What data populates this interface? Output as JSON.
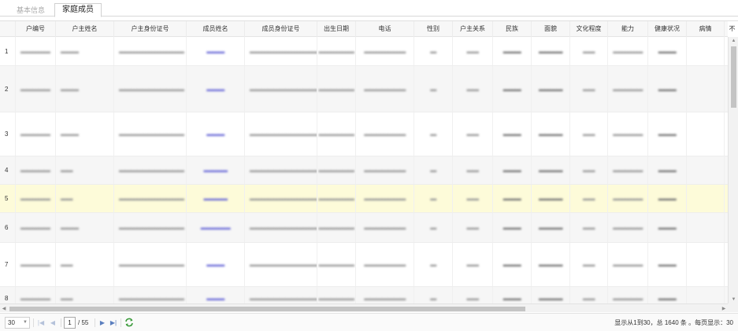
{
  "tabs": [
    {
      "label": "基本信息",
      "active": false
    },
    {
      "label": "家庭成员",
      "active": true
    }
  ],
  "columns": [
    "",
    "户编号",
    "户主姓名",
    "户主身份证号",
    "成员姓名",
    "成员身份证号",
    "出生日期",
    "电话",
    "性别",
    "户主关系",
    "民族",
    "面貌",
    "文化程度",
    "能力",
    "健康状况",
    "病情",
    "不"
  ],
  "rows": [
    {
      "num": "1",
      "cells": [
        "▬▬▬▬▬",
        "▬▬▬",
        "▬▬▬▬▬▬▬▬▬▬▬",
        "▬▬▬",
        "▬▬▬▬▬▬▬▬▬▬▬▬",
        "▬▬▬▬▬▬",
        "▬▬▬▬▬▬▬",
        "▬",
        "▬▬",
        "▬▬▬",
        "▬▬▬▬",
        "▬▬",
        "▬▬▬▬▬",
        "▬▬▬",
        "",
        ":"
      ]
    },
    {
      "num": "2",
      "cells": [
        "▬▬▬▬▬",
        "▬▬▬",
        "▬▬▬▬▬▬▬▬▬▬▬",
        "▬▬▬",
        "▬▬▬▬▬▬▬▬▬▬▬▬",
        "▬▬▬▬▬▬",
        "▬▬▬▬▬▬▬",
        "▬",
        "▬▬",
        "▬▬▬",
        "▬▬▬▬",
        "▬▬",
        "▬▬▬▬▬",
        "▬▬▬",
        "",
        ":"
      ]
    },
    {
      "num": "3",
      "cells": [
        "▬▬▬▬▬",
        "▬▬▬",
        "▬▬▬▬▬▬▬▬▬▬▬",
        "▬▬▬",
        "▬▬▬▬▬▬▬▬▬▬▬▬",
        "▬▬▬▬▬▬",
        "▬▬▬▬▬▬▬",
        "▬",
        "▬▬",
        "▬▬▬",
        "▬▬▬▬",
        "▬▬",
        "▬▬▬▬▬",
        "▬▬▬",
        "",
        ":"
      ]
    },
    {
      "num": "4",
      "cells": [
        "▬▬▬▬▬",
        "▬▬",
        "▬▬▬▬▬▬▬▬▬▬▬",
        "▬▬▬▬",
        "▬▬▬▬▬▬▬▬▬▬▬▬",
        "▬▬▬▬▬▬",
        "▬▬▬▬▬▬▬",
        "▬",
        "▬▬",
        "▬▬▬",
        "▬▬▬▬",
        "▬▬",
        "▬▬▬▬▬",
        "▬▬▬",
        "",
        ":"
      ]
    },
    {
      "num": "5",
      "cells": [
        "▬▬▬▬▬",
        "▬▬",
        "▬▬▬▬▬▬▬▬▬▬▬",
        "▬▬▬▬",
        "▬▬▬▬▬▬▬▬▬▬▬▬",
        "▬▬▬▬▬▬",
        "▬▬▬▬▬▬▬",
        "▬",
        "▬▬",
        "▬▬▬",
        "▬▬▬▬",
        "▬▬",
        "▬▬▬▬▬",
        "▬▬▬",
        "",
        ":"
      ]
    },
    {
      "num": "6",
      "cells": [
        "▬▬▬▬▬",
        "▬▬▬",
        "▬▬▬▬▬▬▬▬▬▬▬",
        "▬▬▬▬▬",
        "▬▬▬▬▬▬▬▬▬▬▬▬",
        "▬▬▬▬▬▬",
        "▬▬▬▬▬▬▬",
        "▬",
        "▬▬",
        "▬▬▬",
        "▬▬▬▬",
        "▬▬",
        "▬▬▬▬▬",
        "▬▬▬",
        "",
        ":"
      ]
    },
    {
      "num": "7",
      "cells": [
        "▬▬▬▬▬",
        "▬▬",
        "▬▬▬▬▬▬▬▬▬▬▬",
        "▬▬▬",
        "▬▬▬▬▬▬▬▬▬▬▬▬",
        "▬▬▬▬▬▬",
        "▬▬▬▬▬▬▬",
        "▬",
        "▬▬",
        "▬▬▬",
        "▬▬▬▬",
        "▬▬",
        "▬▬▬▬▬",
        "▬▬▬",
        "",
        ":"
      ]
    },
    {
      "num": "8",
      "cells": [
        "▬▬▬▬▬",
        "▬▬",
        "▬▬▬▬▬▬▬▬▬▬▬",
        "▬▬▬",
        "▬▬▬▬▬▬▬▬▬▬▬▬",
        "▬▬▬▬▬▬",
        "▬▬▬▬▬▬▬",
        "▬",
        "▬▬",
        "▬▬▬",
        "▬▬▬▬",
        "▬▬",
        "▬▬▬▬▬",
        "▬▬▬",
        "",
        ":"
      ]
    }
  ],
  "pager": {
    "page_size": "30",
    "current_page": "1",
    "total_pages": "/ 55",
    "info": "显示从1到30，总 1640 条 。每页显示：30"
  },
  "icons": {
    "first": "first-page-icon",
    "prev": "prev-page-icon",
    "next": "next-page-icon",
    "last": "last-page-icon",
    "refresh": "refresh-icon"
  }
}
